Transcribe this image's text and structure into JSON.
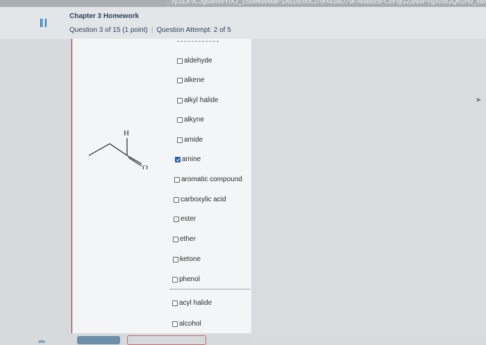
{
  "browser": {
    "url_text": "...ryJ3Jr-ICJgs4RWYlXJ_1SoekWMaP1As1fEhnCl79H4S6U79r-ANBuf5FCeFqG23NoPVgXnxGQh1H9_lfM9c"
  },
  "header": {
    "homework_title": "Chapter 3 Homework",
    "question_label": "Question 3 of 15 (1 point)",
    "separator": "|",
    "attempt_label": "Question Attempt: 2 of 5"
  },
  "molecule": {
    "h_label": "H",
    "o_label": "O"
  },
  "options": [
    {
      "label": "aldehyde",
      "checked": false
    },
    {
      "label": "alkene",
      "checked": false
    },
    {
      "label": "alkyl halide",
      "checked": false
    },
    {
      "label": "alkyne",
      "checked": false
    },
    {
      "label": "amide",
      "checked": false
    },
    {
      "label": "amine",
      "checked": true
    },
    {
      "label": "aromatic compound",
      "checked": false
    },
    {
      "label": "carboxylic acid",
      "checked": false
    },
    {
      "label": "ester",
      "checked": false
    },
    {
      "label": "ether",
      "checked": false
    },
    {
      "label": "ketone",
      "checked": false
    },
    {
      "label": "phenol",
      "checked": false
    },
    {
      "label": "acyl halide",
      "checked": false
    },
    {
      "label": "alcohol",
      "checked": false
    }
  ],
  "colors": {
    "accent": "#1f5fa8",
    "header_text": "#2a3f5a"
  }
}
